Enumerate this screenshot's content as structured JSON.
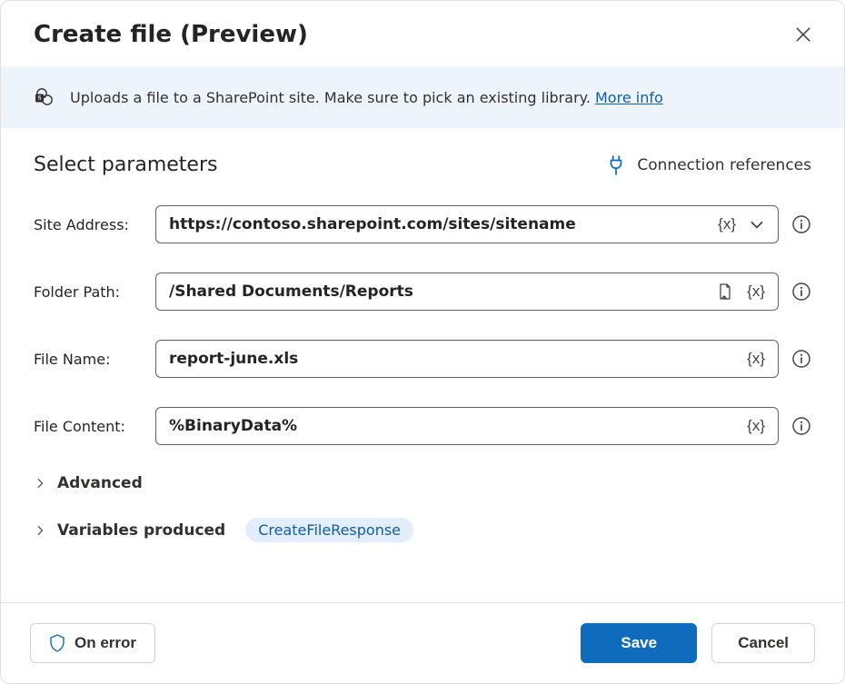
{
  "header": {
    "title": "Create file (Preview)"
  },
  "banner": {
    "text": "Uploads a file to a SharePoint site. Make sure to pick an existing library. ",
    "link_text": "More info"
  },
  "section": {
    "title": "Select parameters",
    "connection_references": "Connection references"
  },
  "fields": {
    "site": {
      "label": "Site Address:",
      "value": "https://contoso.sharepoint.com/sites/sitename",
      "token": "{x}"
    },
    "folder": {
      "label": "Folder Path:",
      "value": "/Shared Documents/Reports",
      "token": "{x}"
    },
    "filename": {
      "label": "File Name:",
      "value": "report-june.xls",
      "token": "{x}"
    },
    "filecontent": {
      "label": "File Content:",
      "value": "%BinaryData%",
      "token": "{x}"
    }
  },
  "expanders": {
    "advanced": "Advanced",
    "variables_produced": "Variables produced",
    "variable_chip": "CreateFileResponse"
  },
  "footer": {
    "on_error": "On error",
    "save": "Save",
    "cancel": "Cancel"
  }
}
